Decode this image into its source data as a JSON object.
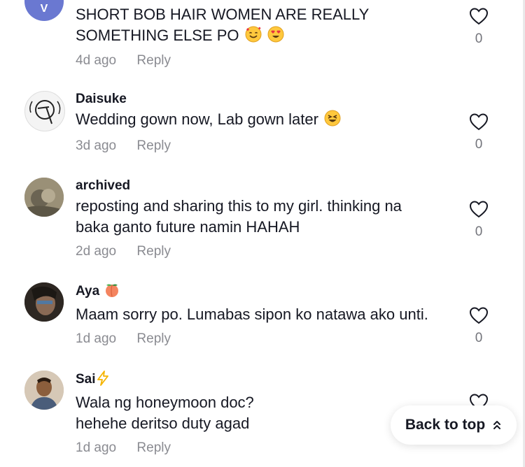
{
  "comments": [
    {
      "username": "",
      "avatar_letter": "V",
      "avatar_color": "#6a78d1",
      "text_lines": [
        "SHORT BOB HAIR WOMEN ARE REALLY",
        "SOMETHING ELSE PO"
      ],
      "emojis": [
        "smiling-face-with-hearts-emoji",
        "heart-eyes-emoji"
      ],
      "time": "4d ago",
      "reply_label": "Reply",
      "like_count": "0"
    },
    {
      "username": "Daisuke",
      "text_lines": [
        "Wedding gown now, Lab gown later"
      ],
      "emojis": [
        "squinting-laughing-emoji"
      ],
      "time": "3d ago",
      "reply_label": "Reply",
      "like_count": "0"
    },
    {
      "username": "archived",
      "text_lines": [
        "reposting and sharing this to my girl. thinking na",
        "baka ganto future namin HAHAH"
      ],
      "time": "2d ago",
      "reply_label": "Reply",
      "like_count": "0"
    },
    {
      "username": "Aya",
      "username_emoji": "peach-emoji",
      "text_lines": [
        "Maam sorry po. Lumabas sipon ko natawa ako unti."
      ],
      "time": "1d ago",
      "reply_label": "Reply",
      "like_count": "0"
    },
    {
      "username": "Sai",
      "username_emoji": "lightning-emoji",
      "text_lines": [
        "Wala ng honeymoon doc?",
        "hehehe deritso duty agad"
      ],
      "time": "1d ago",
      "reply_label": "Reply",
      "like_count": ""
    }
  ],
  "back_to_top": {
    "label": "Back to top",
    "icon": "double-chevron-up-icon"
  },
  "colors": {
    "text": "#161823",
    "meta": "#8a8b91",
    "accent_peach": "#f4845f",
    "lightning": "#f5b400"
  }
}
